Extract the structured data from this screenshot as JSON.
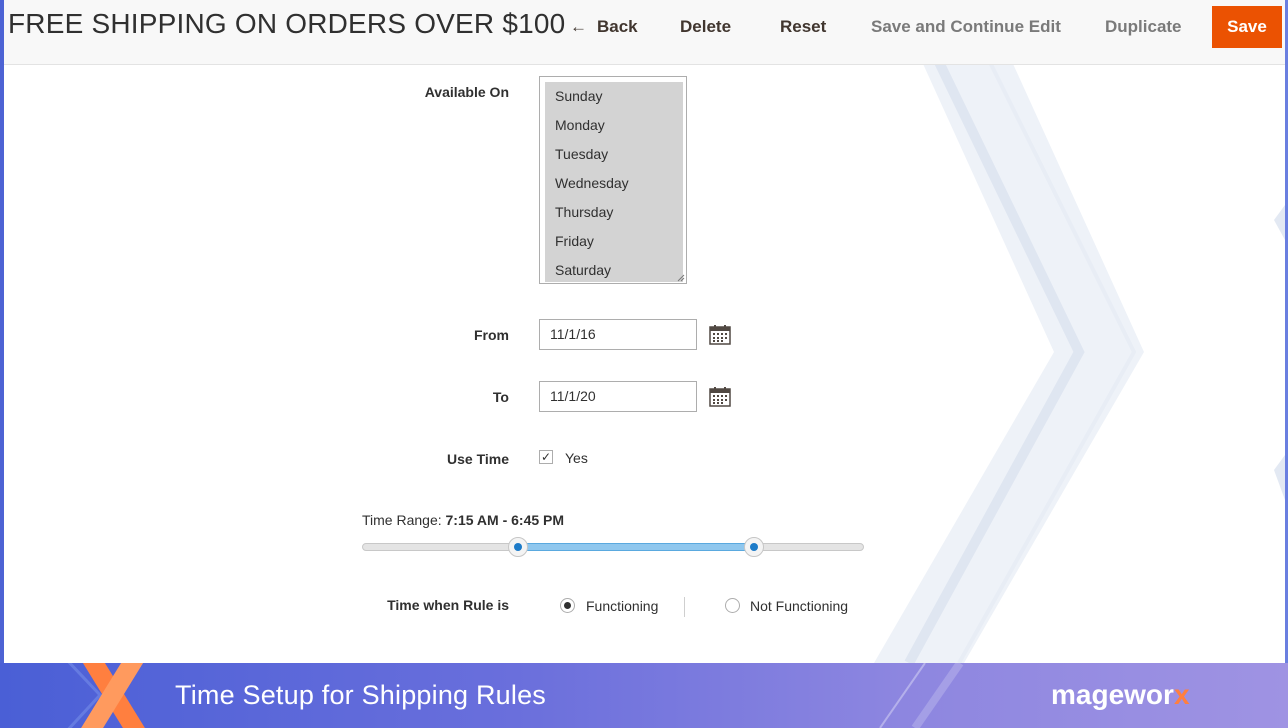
{
  "header": {
    "title": "FREE SHIPPING ON ORDERS OVER $100",
    "back_label": "Back",
    "delete_label": "Delete",
    "reset_label": "Reset",
    "save_continue_label": "Save and Continue Edit",
    "duplicate_label": "Duplicate",
    "save_label": "Save",
    "save_color": "#eb5202"
  },
  "form": {
    "available_on": {
      "label": "Available On",
      "options": [
        "Sunday",
        "Monday",
        "Tuesday",
        "Wednesday",
        "Thursday",
        "Friday",
        "Saturday"
      ]
    },
    "from": {
      "label": "From",
      "value": "11/1/16"
    },
    "to": {
      "label": "To",
      "value": "11/1/20"
    },
    "use_time": {
      "label": "Use Time",
      "checked": true,
      "option_label": "Yes"
    },
    "time_range": {
      "label": "Time Range:",
      "value": "7:15 AM - 6:45 PM",
      "start_fraction": 0.31,
      "end_fraction": 0.78
    },
    "rule_time": {
      "label": "Time when Rule is",
      "options": [
        "Functioning",
        "Not Functioning"
      ],
      "selected": "Functioning"
    }
  },
  "footer": {
    "title": "Time Setup for Shipping Rules",
    "brand_main": "magewor",
    "brand_accent": "x"
  }
}
